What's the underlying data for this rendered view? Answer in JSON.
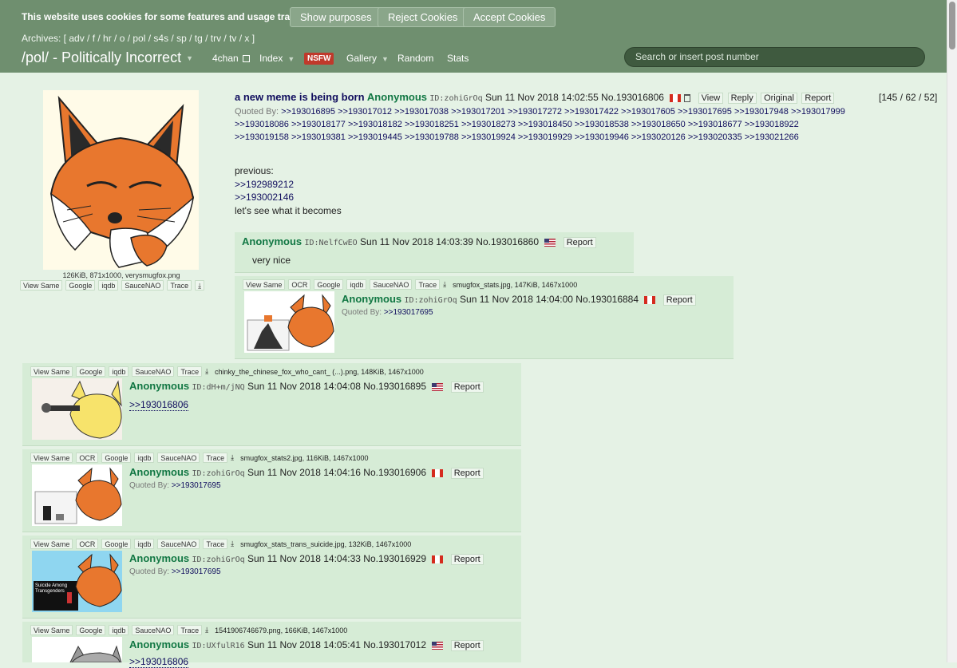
{
  "cookie": {
    "text": "This website uses cookies for some features and usage tracking.",
    "show_purposes": "Show purposes",
    "reject": "Reject Cookies",
    "accept": "Accept Cookies"
  },
  "archives": "Archives: [ adv / f / hr / o / pol / s4s / sp / tg / trv / tv / x ]",
  "board": {
    "title": "/pol/ - Politically Incorrect",
    "nav": {
      "fourchan": "4chan",
      "index": "Index",
      "nsfw": "NSFW",
      "gallery": "Gallery",
      "random": "Random",
      "stats": "Stats"
    },
    "search_placeholder": "Search or insert post number"
  },
  "op": {
    "subject": "a new meme is being born",
    "name": "Anonymous",
    "id": "ID:zohiGrOq",
    "datetime": "Sun 11 Nov 2018 14:02:55",
    "no": "No.193016806",
    "buttons": {
      "view": "View",
      "reply": "Reply",
      "original": "Original",
      "report": "Report"
    },
    "counts": "[145 / 62 / 52]",
    "quoted_label": "Quoted By:",
    "quoted_by": [
      ">>193016895",
      ">>193017012",
      ">>193017038",
      ">>193017201",
      ">>193017272",
      ">>193017422",
      ">>193017605",
      ">>193017695",
      ">>193017948",
      ">>193017999",
      ">>193018086",
      ">>193018177",
      ">>193018182",
      ">>193018251",
      ">>193018273",
      ">>193018450",
      ">>193018538",
      ">>193018650",
      ">>193018677",
      ">>193018922",
      ">>193019158",
      ">>193019381",
      ">>193019445",
      ">>193019788",
      ">>193019924",
      ">>193019929",
      ">>193019946",
      ">>193020126",
      ">>193020335",
      ">>193021266"
    ],
    "body": {
      "l1": "previous:",
      "l2": ">>192989212",
      "l3": ">>193002146",
      "l4": "let's see what it becomes"
    },
    "fileinfo": "126KiB, 871x1000, verysmugfox.png",
    "tools": {
      "view_same": "View Same",
      "google": "Google",
      "iqdb": "iqdb",
      "saucenao": "SauceNAO",
      "trace": "Trace",
      "download": "⤓"
    }
  },
  "tools": {
    "view_same": "View Same",
    "ocr": "OCR",
    "google": "Google",
    "iqdb": "iqdb",
    "saucenao": "SauceNAO",
    "trace": "Trace",
    "download": "⤓",
    "report": "Report",
    "quoted_label": "Quoted By:"
  },
  "replies": {
    "r1": {
      "name": "Anonymous",
      "id": "ID:NelfCwEO",
      "datetime": "Sun 11 Nov 2018 14:03:39",
      "no": "No.193016860",
      "text": "very nice"
    },
    "r2": {
      "file": "smugfox_stats.jpg, 147KiB, 1467x1000",
      "name": "Anonymous",
      "id": "ID:zohiGrOq",
      "datetime": "Sun 11 Nov 2018 14:04:00",
      "no": "No.193016884",
      "quoted": ">>193017695"
    },
    "r3": {
      "file": "chinky_the_chinese_fox_who_cant_ (...).png, 148KiB, 1467x1000",
      "name": "Anonymous",
      "id": "ID:dH+m/jNQ",
      "datetime": "Sun 11 Nov 2018 14:04:08",
      "no": "No.193016895",
      "link": ">>193016806"
    },
    "r4": {
      "file": "smugfox_stats2.jpg, 116KiB, 1467x1000",
      "name": "Anonymous",
      "id": "ID:zohiGrOq",
      "datetime": "Sun 11 Nov 2018 14:04:16",
      "no": "No.193016906",
      "quoted": ">>193017695"
    },
    "r5": {
      "file": "smugfox_stats_trans_suicide.jpg, 132KiB, 1467x1000",
      "name": "Anonymous",
      "id": "ID:zohiGrOq",
      "datetime": "Sun 11 Nov 2018 14:04:33",
      "no": "No.193016929",
      "quoted": ">>193017695",
      "thumb_text": "Suicide Among Transgenders"
    },
    "r6": {
      "file": "1541906746679.png, 166KiB, 1467x1000",
      "name": "Anonymous",
      "id": "ID:UXfulR16",
      "datetime": "Sun 11 Nov 2018 14:05:41",
      "no": "No.193017012",
      "link": ">>193016806"
    }
  }
}
